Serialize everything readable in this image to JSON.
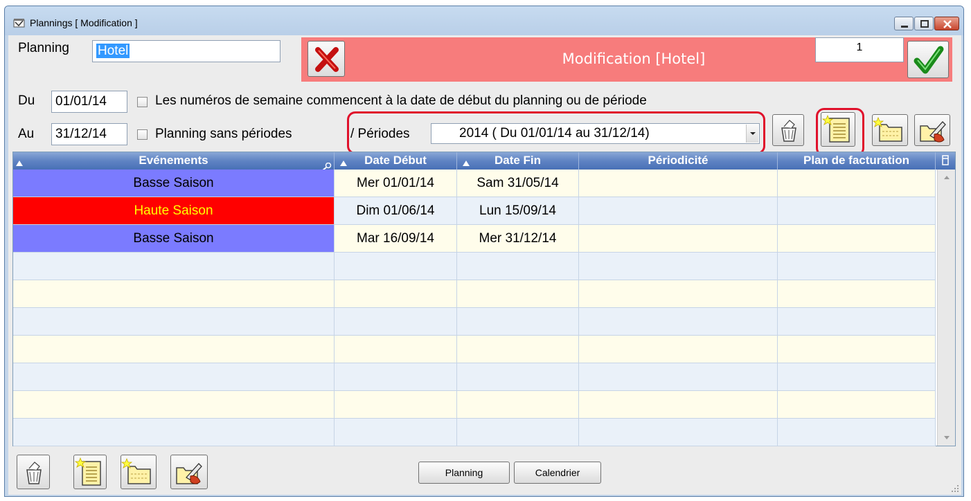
{
  "window": {
    "title": "Plannings [ Modification ]",
    "icons": {
      "app": "calendar-app-icon",
      "minimize": "minimize-icon",
      "maximize": "maximize-icon",
      "close": "close-icon"
    }
  },
  "header": {
    "planning_label": "Planning",
    "planning_value": "Hotel",
    "cancel_icon": "red-x-icon",
    "title": "Modification [Hotel]",
    "counter_value": "1",
    "validate_icon": "green-check-icon",
    "banner_color": "#f77c7c"
  },
  "dates": {
    "du_label": "Du",
    "du_value": "01/01/14",
    "au_label": "Au",
    "au_value": "31/12/14",
    "week_option_label": "Les numéros de semaine commencent à la date de début du planning ou de période",
    "no_periods_label": "Planning sans périodes",
    "periods_label": "/ Périodes",
    "periods_selected": "2014 ( Du 01/01/14 au 31/12/14)"
  },
  "period_toolbar": [
    {
      "name": "trash-icon"
    },
    {
      "name": "new-list-icon"
    },
    {
      "name": "new-folder-icon"
    },
    {
      "name": "edit-hand-icon"
    }
  ],
  "table": {
    "columns": [
      "Evénements",
      "Date Début",
      "Date Fin",
      "Périodicité",
      "Plan de facturation"
    ],
    "rows": [
      {
        "event": "Basse Saison",
        "start": "Mer 01/01/14",
        "end": "Sam 31/05/14",
        "periodicity": "",
        "billing": "",
        "color": "#7b7bff",
        "text_color": "#000000"
      },
      {
        "event": "Haute Saison",
        "start": "Dim 01/06/14",
        "end": "Lun 15/09/14",
        "periodicity": "",
        "billing": "",
        "color": "#ff0000",
        "text_color": "#ffff00"
      },
      {
        "event": "Basse Saison",
        "start": "Mar 16/09/14",
        "end": "Mer 31/12/14",
        "periodicity": "",
        "billing": "",
        "color": "#7b7bff",
        "text_color": "#000000"
      }
    ],
    "header_color": "#5f83c3"
  },
  "bottom": {
    "planning_button": "Planning",
    "calendar_button": "Calendrier"
  },
  "colors": {
    "highlight": "#e0102b",
    "selection": "#3399ff"
  }
}
